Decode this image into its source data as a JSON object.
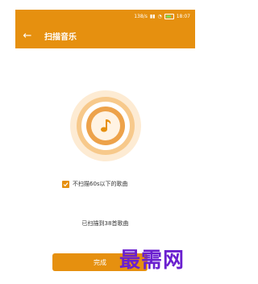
{
  "status_bar": {
    "net_speed": "138/s",
    "time": "18:07"
  },
  "app_bar": {
    "title": "扫描音乐"
  },
  "option": {
    "label": "不扫描60s以下的歌曲",
    "checked": true
  },
  "scan": {
    "status_text": "已扫描到38首歌曲"
  },
  "actions": {
    "done_label": "完成"
  },
  "watermark": {
    "text": "最需网"
  },
  "colors": {
    "accent": "#e6900f",
    "ring_light": "#fdebd3",
    "ring_mid": "#f7c98b",
    "ring_dark": "#eda24a",
    "watermark": "#6a1fcf"
  },
  "icons": {
    "back": "arrow-left-icon",
    "center": "music-note-icon",
    "check": "check-icon"
  }
}
